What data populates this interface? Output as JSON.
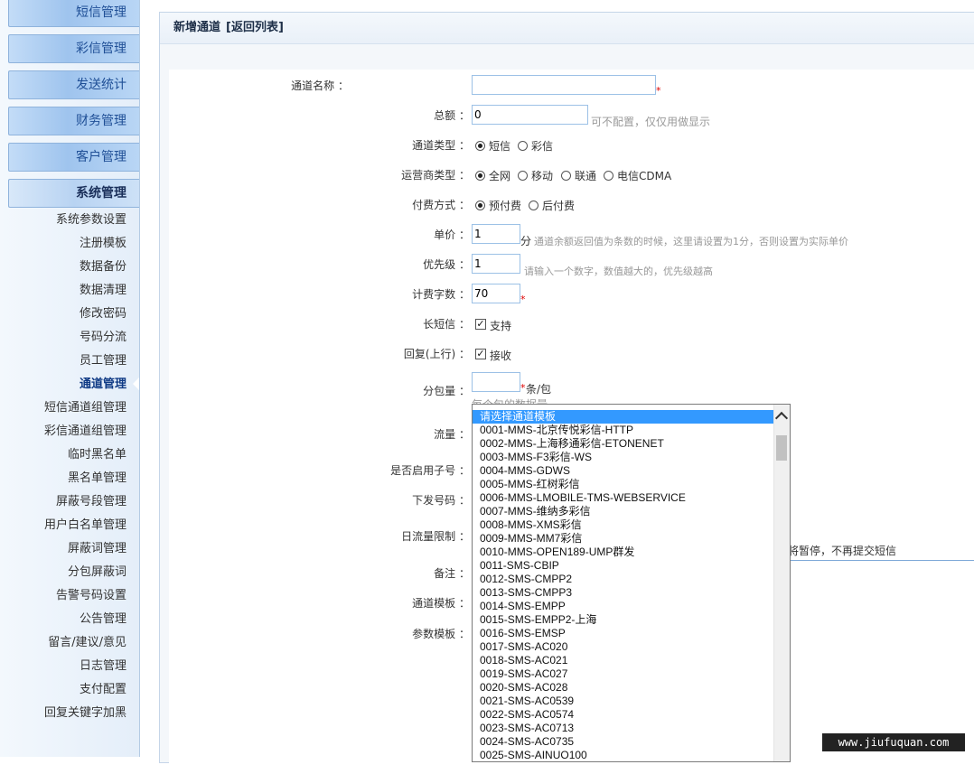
{
  "sidebar": {
    "categories": [
      "短信管理",
      "彩信管理",
      "发送统计",
      "财务管理",
      "客户管理",
      "系统管理"
    ],
    "items": [
      "系统参数设置",
      "注册模板",
      "数据备份",
      "数据清理",
      "修改密码",
      "号码分流",
      "员工管理",
      "通道管理",
      "短信通道组管理",
      "彩信通道组管理",
      "临时黑名单",
      "黑名单管理",
      "屏蔽号段管理",
      "用户白名单管理",
      "屏蔽词管理",
      "分包屏蔽词",
      "告警号码设置",
      "公告管理",
      "留言/建议/意见",
      "日志管理",
      "支付配置",
      "回复关键字加黑"
    ]
  },
  "panel": {
    "title": "新增通道",
    "back_link": "[返回列表]"
  },
  "form": {
    "name_label": "通道名称 ：",
    "name_value": "",
    "total_label": "总额 ：",
    "total_value": "0",
    "total_hint": "可不配置，仅仅用做显示",
    "type_label": "通道类型 ：",
    "type_options": [
      "短信",
      "彩信"
    ],
    "type_selected": "短信",
    "carrier_label": "运营商类型 ：",
    "carrier_options": [
      "全网",
      "移动",
      "联通",
      "电信CDMA"
    ],
    "carrier_selected": "全网",
    "pay_label": "付费方式 ：",
    "pay_options": [
      "预付费",
      "后付费"
    ],
    "pay_selected": "预付费",
    "price_label": "单价 ：",
    "price_value": "1",
    "price_unit": "分",
    "price_hint": "通道余额返回值为条数的时候，这里请设置为1分，否则设置为实际单价",
    "priority_label": "优先级 ：",
    "priority_value": "1",
    "priority_hint": "请输入一个数字，数值越大的，优先级越高",
    "charge_label": "计费字数 ：",
    "charge_value": "70",
    "long_label": "长短信 ：",
    "long_text": "支持",
    "long_checked": true,
    "reply_label": "回复(上行) ：",
    "reply_text": "接收",
    "reply_checked": true,
    "packet_label": "分包量 ：",
    "packet_value": "",
    "packet_unit": "条/包",
    "packet_hint_partial": "每个包的数据量",
    "flow_label": "流量 ：",
    "subnum_label": "是否启用子号 ：",
    "sendnum_label": "下发号码 ：",
    "daily_label": "日流量限制 ：",
    "daily_hint_partial": "将暂停，不再提交短信",
    "remark_label": "备注 ：",
    "template_label": "通道模板 ：",
    "param_label": "参数模板 ："
  },
  "dropdown": {
    "options": [
      "请选择通道模板",
      "0001-MMS-北京传悦彩信-HTTP",
      "0002-MMS-上海移通彩信-ETONENET",
      "0003-MMS-F3彩信-WS",
      "0004-MMS-GDWS",
      "0005-MMS-红树彩信",
      "0006-MMS-LMOBILE-TMS-WEBSERVICE",
      "0007-MMS-维纳多彩信",
      "0008-MMS-XMS彩信",
      "0009-MMS-MM7彩信",
      "0010-MMS-OPEN189-UMP群发",
      "0011-SMS-CBIP",
      "0012-SMS-CMPP2",
      "0013-SMS-CMPP3",
      "0014-SMS-EMPP",
      "0015-SMS-EMPP2-上海",
      "0016-SMS-EMSP",
      "0017-SMS-AC020",
      "0018-SMS-AC021",
      "0019-SMS-AC027",
      "0020-SMS-AC028",
      "0021-SMS-AC0539",
      "0022-SMS-AC0574",
      "0023-SMS-AC0713",
      "0024-SMS-AC0735",
      "0025-SMS-AINUO100"
    ],
    "selected_index": 0
  },
  "watermark": "www.jiufuquan.com"
}
